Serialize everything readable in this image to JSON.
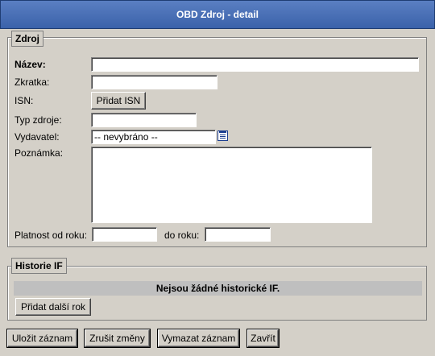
{
  "window": {
    "title": "OBD Zdroj - detail"
  },
  "zdroj": {
    "legend": "Zdroj",
    "nazev_label": "Název:",
    "nazev_value": "",
    "zkratka_label": "Zkratka:",
    "zkratka_value": "",
    "isn_label": "ISN:",
    "pridat_isn_button": "Přidat ISN",
    "typ_label": "Typ zdroje:",
    "typ_value": "",
    "vydavatel_label": "Vydavatel:",
    "vydavatel_value": "-- nevybráno --",
    "poznamka_label": "Poznámka:",
    "poznamka_value": "",
    "platnost_od_label": "Platnost od roku:",
    "platnost_od_value": "",
    "do_roku_label": "do roku:",
    "do_roku_value": ""
  },
  "historie": {
    "legend": "Historie IF",
    "empty_message": "Nejsou žádné historické IF.",
    "add_button": "Přidat další rok"
  },
  "actions": {
    "save": "Uložit záznam",
    "cancel": "Zrušit změny",
    "delete": "Vymazat záznam",
    "close": "Zavřít"
  },
  "icons": {
    "vydavatel_lookup": "list-picker-icon"
  }
}
